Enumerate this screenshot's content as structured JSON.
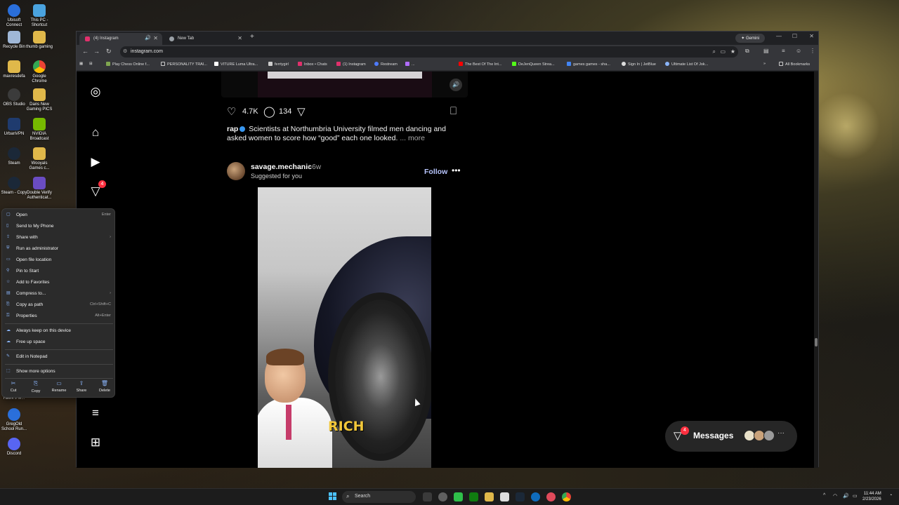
{
  "desktop": {
    "icons": [
      {
        "label": "Ubisoft Connect",
        "color": "#2a6fdb"
      },
      {
        "label": "This PC - Shortcut",
        "color": "#4aa3df"
      },
      {
        "label": "Recycle Bin",
        "color": "#9fb7d6"
      },
      {
        "label": "thumb gaming",
        "color": "#e0b84a"
      },
      {
        "label": "maxresdefa",
        "color": "#e0b84a"
      },
      {
        "label": "Google Chrome",
        "color": "#34a853"
      },
      {
        "label": "OBS Studio",
        "color": "#3b3b3b"
      },
      {
        "label": "Dans New Gaming PICS",
        "color": "#e0b84a"
      },
      {
        "label": "UrbanVPN",
        "color": "#1f3b6e"
      },
      {
        "label": "NVIDIA Broadcast",
        "color": "#76b900"
      },
      {
        "label": "Steam",
        "color": "#1b2838"
      },
      {
        "label": "Wooyals Games c...",
        "color": "#e0b84a"
      },
      {
        "label": "Steam - Copy",
        "color": "#1b2838"
      },
      {
        "label": "Double Verify Authenticat...",
        "color": "#6a4cc2"
      },
      {
        "label": "Hawk's M...",
        "color": "#444"
      },
      {
        "label": "GregOld School Run...",
        "color": "#2a6fdb"
      },
      {
        "label": "Discord",
        "color": "#5865f2"
      }
    ]
  },
  "browser": {
    "tabs": [
      {
        "label": "(4) Instagram",
        "favicon_color": "#e1306c"
      },
      {
        "label": "New Tab",
        "favicon_color": "#9aa0a6"
      }
    ],
    "gemini_label": "Gemini",
    "url": "instagram.com",
    "bookmarks": [
      "Play Chess Online f...",
      "PERSONALITY TRAI...",
      "VITURE Luma Ultra...",
      "ferrtygirl",
      "Inbox • Chats",
      "(1) Instagram",
      "Restream",
      "...",
      "The Best Of The Int...",
      "DeJenQueen Strea...",
      "games games - sha...",
      "Sign In | JetBlue",
      "Ultimate List Of Jok..."
    ],
    "all_bookmarks": "All Bookmarks"
  },
  "instagram": {
    "nav": {
      "notifications_badge": "4"
    },
    "prev_post": {
      "likes": "4.7K",
      "comments": "134",
      "caption_user": "rap",
      "caption_text": "Scientists at Northumbria University filmed men dancing and asked women to score how “good” each one looked.",
      "caption_more": "... more"
    },
    "post": {
      "username": "savage.mechanic",
      "time": "• 6w",
      "subtitle": "Suggested for you",
      "follow_label": "Follow",
      "more_label": "•••",
      "overlay_text": "RICH"
    },
    "messages": {
      "label": "Messages",
      "badge": "4",
      "more": "···"
    }
  },
  "context_menu": {
    "items": [
      {
        "label": "Open",
        "shortcut": "Enter",
        "icon": "open-icon"
      },
      {
        "label": "Send to My Phone",
        "shortcut": "",
        "icon": "phone-icon"
      },
      {
        "label": "Share with",
        "shortcut": "›",
        "icon": "share-with-icon"
      },
      {
        "label": "Run as administrator",
        "shortcut": "",
        "icon": "shield-icon"
      },
      {
        "label": "Open file location",
        "shortcut": "",
        "icon": "folder-icon"
      },
      {
        "label": "Pin to Start",
        "shortcut": "",
        "icon": "pin-icon"
      },
      {
        "label": "Add to Favorites",
        "shortcut": "",
        "icon": "star-icon"
      },
      {
        "label": "Compress to...",
        "shortcut": "›",
        "icon": "zip-icon"
      },
      {
        "label": "Copy as path",
        "shortcut": "Ctrl+Shift+C",
        "icon": "path-icon"
      },
      {
        "label": "Properties",
        "shortcut": "Alt+Enter",
        "icon": "properties-icon"
      },
      {
        "label": "Always keep on this device",
        "shortcut": "",
        "icon": "cloud-keep-icon"
      },
      {
        "label": "Free up space",
        "shortcut": "",
        "icon": "cloud-icon"
      },
      {
        "label": "Edit in Notepad",
        "shortcut": "",
        "icon": "notepad-icon"
      },
      {
        "label": "Show more options",
        "shortcut": "",
        "icon": "more-options-icon"
      }
    ],
    "bottom_actions": [
      "Cut",
      "Copy",
      "Rename",
      "Share",
      "Delete"
    ]
  },
  "taskbar": {
    "search_placeholder": "Search",
    "time": "11:44 AM",
    "date": "2/23/2026"
  }
}
